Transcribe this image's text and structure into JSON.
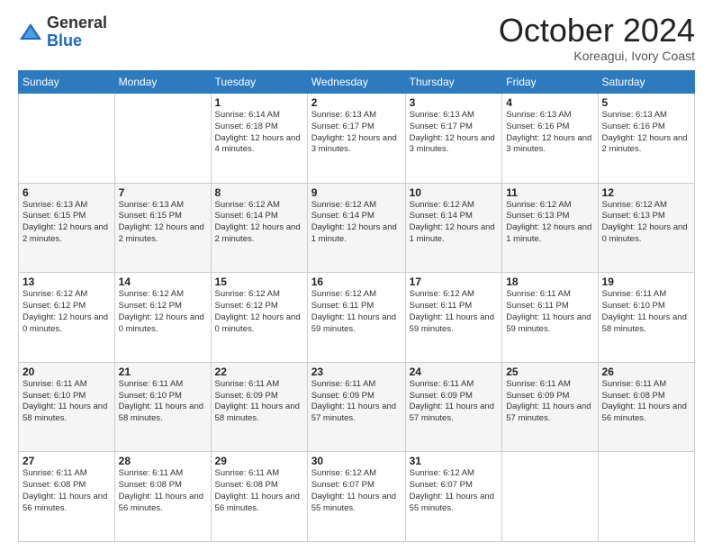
{
  "logo": {
    "general": "General",
    "blue": "Blue"
  },
  "header": {
    "month": "October 2024",
    "location": "Koreagui, Ivory Coast"
  },
  "weekdays": [
    "Sunday",
    "Monday",
    "Tuesday",
    "Wednesday",
    "Thursday",
    "Friday",
    "Saturday"
  ],
  "weeks": [
    [
      {
        "day": "",
        "info": ""
      },
      {
        "day": "",
        "info": ""
      },
      {
        "day": "1",
        "info": "Sunrise: 6:14 AM\nSunset: 6:18 PM\nDaylight: 12 hours and 4 minutes."
      },
      {
        "day": "2",
        "info": "Sunrise: 6:13 AM\nSunset: 6:17 PM\nDaylight: 12 hours and 3 minutes."
      },
      {
        "day": "3",
        "info": "Sunrise: 6:13 AM\nSunset: 6:17 PM\nDaylight: 12 hours and 3 minutes."
      },
      {
        "day": "4",
        "info": "Sunrise: 6:13 AM\nSunset: 6:16 PM\nDaylight: 12 hours and 3 minutes."
      },
      {
        "day": "5",
        "info": "Sunrise: 6:13 AM\nSunset: 6:16 PM\nDaylight: 12 hours and 2 minutes."
      }
    ],
    [
      {
        "day": "6",
        "info": "Sunrise: 6:13 AM\nSunset: 6:15 PM\nDaylight: 12 hours and 2 minutes."
      },
      {
        "day": "7",
        "info": "Sunrise: 6:13 AM\nSunset: 6:15 PM\nDaylight: 12 hours and 2 minutes."
      },
      {
        "day": "8",
        "info": "Sunrise: 6:12 AM\nSunset: 6:14 PM\nDaylight: 12 hours and 2 minutes."
      },
      {
        "day": "9",
        "info": "Sunrise: 6:12 AM\nSunset: 6:14 PM\nDaylight: 12 hours and 1 minute."
      },
      {
        "day": "10",
        "info": "Sunrise: 6:12 AM\nSunset: 6:14 PM\nDaylight: 12 hours and 1 minute."
      },
      {
        "day": "11",
        "info": "Sunrise: 6:12 AM\nSunset: 6:13 PM\nDaylight: 12 hours and 1 minute."
      },
      {
        "day": "12",
        "info": "Sunrise: 6:12 AM\nSunset: 6:13 PM\nDaylight: 12 hours and 0 minutes."
      }
    ],
    [
      {
        "day": "13",
        "info": "Sunrise: 6:12 AM\nSunset: 6:12 PM\nDaylight: 12 hours and 0 minutes."
      },
      {
        "day": "14",
        "info": "Sunrise: 6:12 AM\nSunset: 6:12 PM\nDaylight: 12 hours and 0 minutes."
      },
      {
        "day": "15",
        "info": "Sunrise: 6:12 AM\nSunset: 6:12 PM\nDaylight: 12 hours and 0 minutes."
      },
      {
        "day": "16",
        "info": "Sunrise: 6:12 AM\nSunset: 6:11 PM\nDaylight: 11 hours and 59 minutes."
      },
      {
        "day": "17",
        "info": "Sunrise: 6:12 AM\nSunset: 6:11 PM\nDaylight: 11 hours and 59 minutes."
      },
      {
        "day": "18",
        "info": "Sunrise: 6:11 AM\nSunset: 6:11 PM\nDaylight: 11 hours and 59 minutes."
      },
      {
        "day": "19",
        "info": "Sunrise: 6:11 AM\nSunset: 6:10 PM\nDaylight: 11 hours and 58 minutes."
      }
    ],
    [
      {
        "day": "20",
        "info": "Sunrise: 6:11 AM\nSunset: 6:10 PM\nDaylight: 11 hours and 58 minutes."
      },
      {
        "day": "21",
        "info": "Sunrise: 6:11 AM\nSunset: 6:10 PM\nDaylight: 11 hours and 58 minutes."
      },
      {
        "day": "22",
        "info": "Sunrise: 6:11 AM\nSunset: 6:09 PM\nDaylight: 11 hours and 58 minutes."
      },
      {
        "day": "23",
        "info": "Sunrise: 6:11 AM\nSunset: 6:09 PM\nDaylight: 11 hours and 57 minutes."
      },
      {
        "day": "24",
        "info": "Sunrise: 6:11 AM\nSunset: 6:09 PM\nDaylight: 11 hours and 57 minutes."
      },
      {
        "day": "25",
        "info": "Sunrise: 6:11 AM\nSunset: 6:09 PM\nDaylight: 11 hours and 57 minutes."
      },
      {
        "day": "26",
        "info": "Sunrise: 6:11 AM\nSunset: 6:08 PM\nDaylight: 11 hours and 56 minutes."
      }
    ],
    [
      {
        "day": "27",
        "info": "Sunrise: 6:11 AM\nSunset: 6:08 PM\nDaylight: 11 hours and 56 minutes."
      },
      {
        "day": "28",
        "info": "Sunrise: 6:11 AM\nSunset: 6:08 PM\nDaylight: 11 hours and 56 minutes."
      },
      {
        "day": "29",
        "info": "Sunrise: 6:11 AM\nSunset: 6:08 PM\nDaylight: 11 hours and 56 minutes."
      },
      {
        "day": "30",
        "info": "Sunrise: 6:12 AM\nSunset: 6:07 PM\nDaylight: 11 hours and 55 minutes."
      },
      {
        "day": "31",
        "info": "Sunrise: 6:12 AM\nSunset: 6:07 PM\nDaylight: 11 hours and 55 minutes."
      },
      {
        "day": "",
        "info": ""
      },
      {
        "day": "",
        "info": ""
      }
    ]
  ]
}
